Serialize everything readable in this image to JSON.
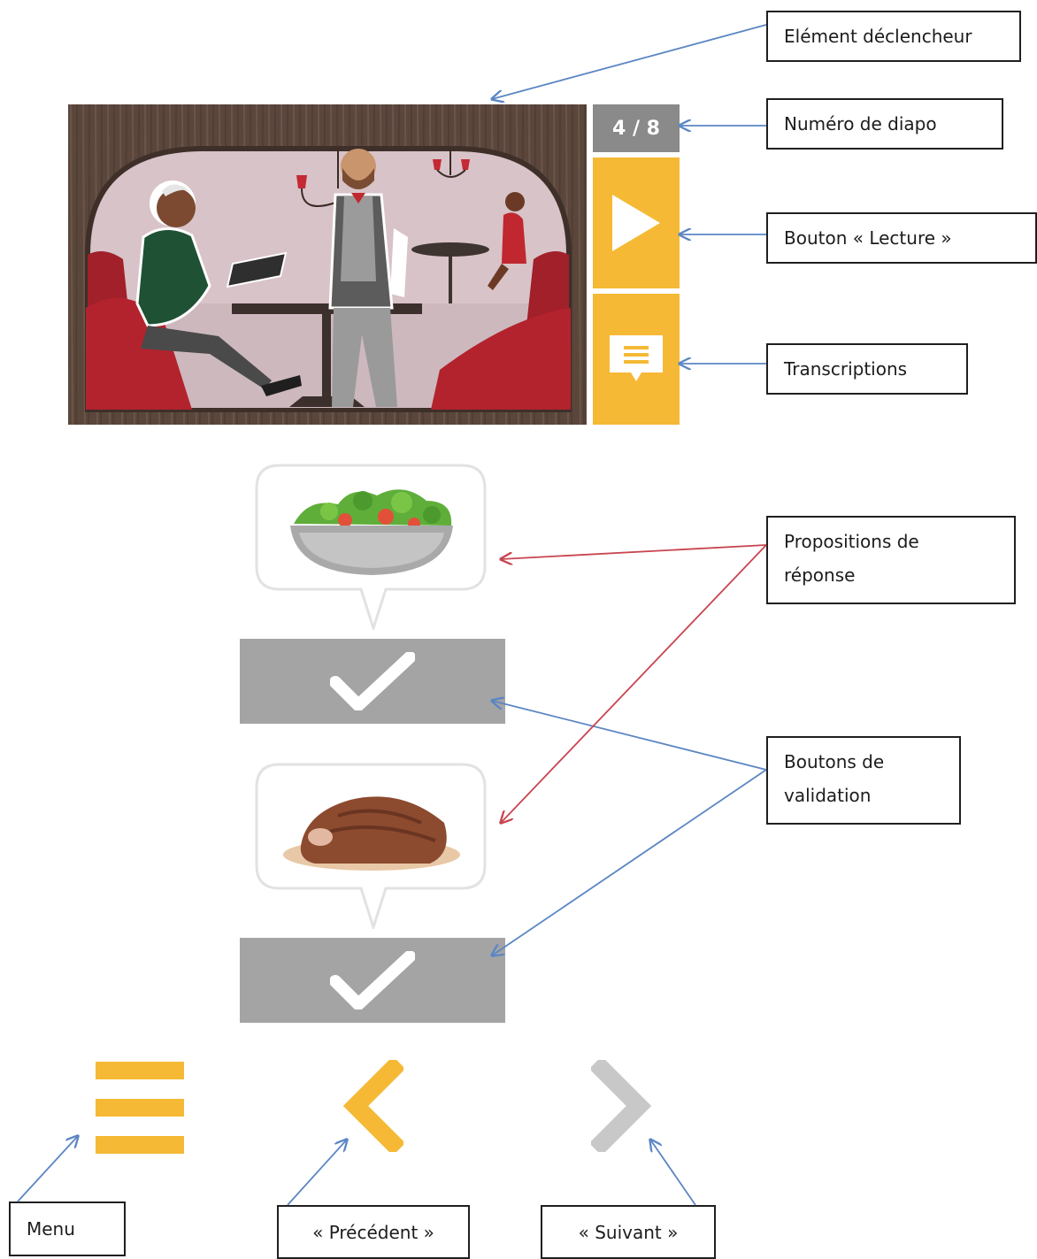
{
  "slide": {
    "counter": "4 / 8"
  },
  "labels": {
    "trigger": "Elément déclencheur",
    "slide_number": "Numéro de diapo",
    "play_button": "Bouton « Lecture »",
    "transcriptions": "Transcriptions",
    "answer_options_line1": "Propositions de",
    "answer_options_line2": "réponse",
    "validation_buttons_line1": "Boutons de",
    "validation_buttons_line2": "validation",
    "menu": "Menu",
    "previous": "« Précédent »",
    "next": "« Suivant »"
  },
  "icons": {
    "play": "play-icon",
    "transcript": "speech-bubble-icon",
    "validate": "checkmark-icon",
    "menu": "hamburger-menu-icon",
    "previous": "chevron-left-icon",
    "next": "chevron-right-icon",
    "answer_1": "salad-bowl-icon",
    "answer_2": "steak-icon"
  },
  "colors": {
    "accent": "#f5b935",
    "counter_bg": "#8a8a8a",
    "validate_bg": "#a4a4a4",
    "next_disabled": "#c8c8c8",
    "arrow_blue": "#5b86c4",
    "arrow_red": "#c8454f"
  }
}
